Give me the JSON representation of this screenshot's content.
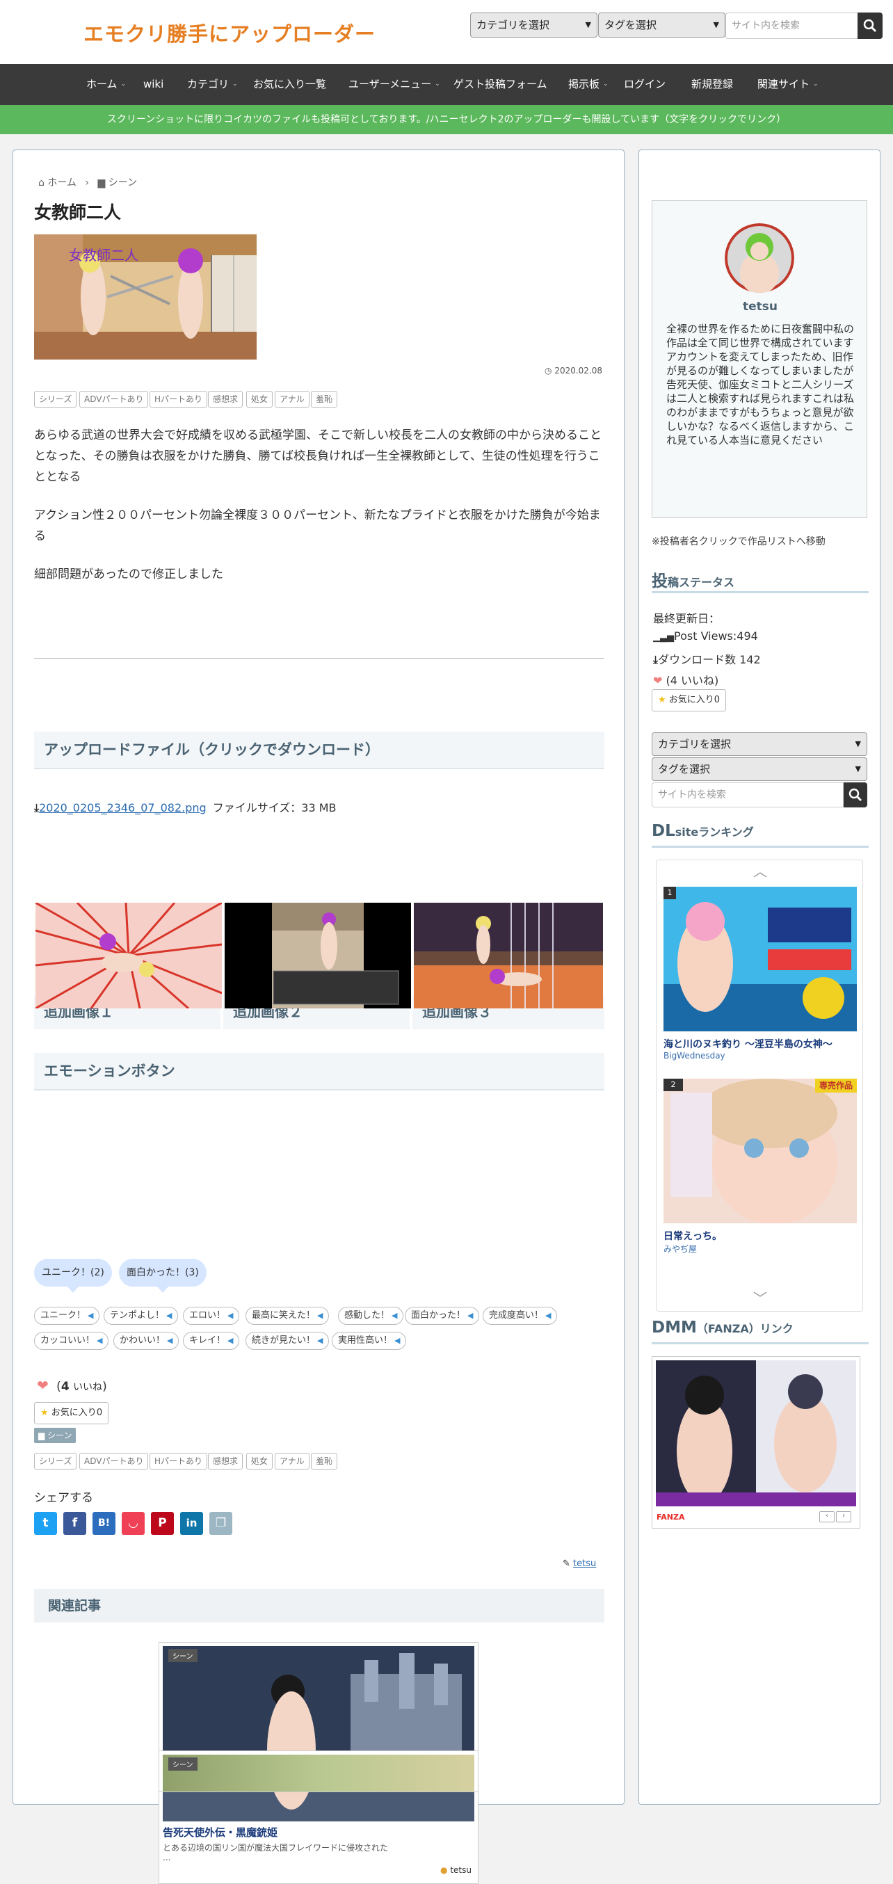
{
  "site": {
    "logo": "エモクリ勝手にアップローダー",
    "header_category_select": "カテゴリを選択",
    "header_tag_select": "タグを選択",
    "header_search_placeholder": "サイト内を検索"
  },
  "nav": [
    "ホーム",
    "wiki",
    "カテゴリ",
    "お気に入り一覧",
    "ユーザーメニュー",
    "ゲスト投稿フォーム",
    "掲示板",
    "ログイン",
    "新規登録",
    "関連サイト"
  ],
  "notice": "スクリーンショットに限りコイカツのファイルも投稿可としております。/ハニーセレクト2のアップローダーも開設しています（文字をクリックでリンク）",
  "breadcrumb": {
    "home": "ホーム",
    "category": "シーン"
  },
  "article": {
    "title": "女教師二人",
    "date": "2020.02.08",
    "thumb_caption": "女教師二人",
    "tags": [
      "シリーズ",
      "ADVパートあり",
      "Hパートあり",
      "感想求",
      "処女",
      "アナル",
      "羞恥"
    ],
    "paragraphs": [
      "あらゆる武道の世界大会で好成績を収める武極学園、そこで新しい校長を二人の女教師の中から決めることとなった、その勝負は衣服をかけた勝負、勝てば校長負ければ一生全裸教師として、生徒の性処理を行うこととなる",
      "アクション性２００パーセント勿論全裸度３００パーセント、新たなプライドと衣服をかけた勝負が今始まる",
      "細部問題があったので修正しました"
    ]
  },
  "upload": {
    "heading": "アップロードファイル（クリックでダウンロード）",
    "filename": "2020_0205_2346_07_082.png",
    "filesize": "ファイルサイズ：33 MB"
  },
  "extra_images": [
    "追加画像１",
    "追加画像２",
    "追加画像３"
  ],
  "emotion": {
    "heading": "エモーションボタン",
    "counts": [
      "ユニーク！(2)",
      "面白かった！(3)"
    ],
    "buttons": [
      "ユニーク！",
      "テンポよし！",
      "エロい！",
      "最高に笑えた！",
      "感動した！",
      "面白かった！",
      "完成度高い！",
      "カッコいい！",
      "かわいい！",
      "キレイ！",
      "続きが見たい！",
      "実用性高い！"
    ]
  },
  "likes": {
    "count": "4",
    "label": "いいね"
  },
  "favorite": {
    "label": "お気に入り",
    "count": "0"
  },
  "category_badge": "シーン",
  "share": {
    "label": "シェアする",
    "buttons": [
      "twitter",
      "facebook",
      "hatena",
      "pocket",
      "pinterest",
      "linkedin",
      "copy"
    ]
  },
  "author": "tetsu",
  "related": {
    "heading": "関連記事",
    "items": [
      {
        "badge": "シーン",
        "title": "告死天使外伝・黒魔銃姫",
        "excerpt": "とある辺境の国リン国が魔法大国フレイワードに侵攻された",
        "ellipsis": "...",
        "author": "tetsu"
      },
      {
        "badge": "シーン"
      }
    ]
  },
  "sidebar": {
    "profile": {
      "name": "tetsu",
      "bio": "全裸の世界を作るために日夜奮闘中私の作品は全て同じ世界で構成されていますアカウントを変えてしまったため、旧作が見るのが難しくなってしまいましたが告死天使、伽座女ミコトと二人シリーズは二人と検索すれば見られますこれは私のわがままですがもうちょっと意見が欲しいかな？なるべく返信しますから、これ見ている人本当に意見ください"
    },
    "profile_note": "※投稿者名クリックで作品リストへ移動",
    "status": {
      "heading_big": "投",
      "heading_rest": "稿ステータス",
      "last_updated": "最終更新日：",
      "post_views": "Post Views:494",
      "downloads": "ダウンロード数 142",
      "likes": "(4 いいね)",
      "fav": "お気に入り0"
    },
    "category_select": "カテゴリを選択",
    "tag_select": "タグを選択",
    "search_placeholder": "サイト内を検索",
    "dlsite": {
      "heading_big": "DL",
      "heading_rest": "siteランキング",
      "items": [
        {
          "rank": "1",
          "title": "海と川のヌキ釣り ～淫豆半島の女神～",
          "maker": "BigWednesday"
        },
        {
          "rank": "2",
          "title": "日常えっち。",
          "maker": "みやぢ屋",
          "badge": "専売作品"
        }
      ]
    },
    "dmm": {
      "heading_big": "DMM",
      "heading_rest": "（FANZA）リンク",
      "brand": "FANZA"
    }
  },
  "colors": {
    "accent": "#e67e22",
    "nav": "#3a3a3a",
    "notice": "#5cb85c",
    "link": "#2a6bb0"
  }
}
